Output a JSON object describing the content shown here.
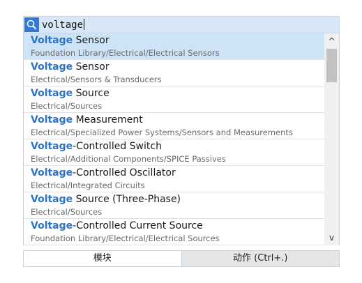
{
  "search": {
    "value": "voltage"
  },
  "results": [
    {
      "highlight": "Voltage",
      "rest": " Sensor",
      "path": "Foundation Library/Electrical/Electrical Sensors",
      "selected": true
    },
    {
      "highlight": "Voltage",
      "rest": " Sensor",
      "path": "Electrical/Sensors & Transducers"
    },
    {
      "highlight": "Voltage",
      "rest": " Source",
      "path": "Electrical/Sources"
    },
    {
      "highlight": "Voltage",
      "rest": " Measurement",
      "path": "Electrical/Specialized Power Systems/Sensors and Measurements"
    },
    {
      "highlight": "Voltage",
      "rest": "-Controlled Switch",
      "path": "Electrical/Additional Components/SPICE Passives"
    },
    {
      "highlight": "Voltage",
      "rest": "-Controlled Oscillator",
      "path": "Electrical/Integrated Circuits"
    },
    {
      "highlight": "Voltage",
      "rest": " Source (Three-Phase)",
      "path": "Electrical/Sources"
    },
    {
      "highlight": "Voltage",
      "rest": "-Controlled Current Source",
      "path": "Foundation Library/Electrical/Electrical Sources"
    }
  ],
  "scrollbar": {
    "up": "^",
    "down": "v"
  },
  "tabs": [
    {
      "label": "模块"
    },
    {
      "label": "动作 (Ctrl+.)"
    }
  ]
}
